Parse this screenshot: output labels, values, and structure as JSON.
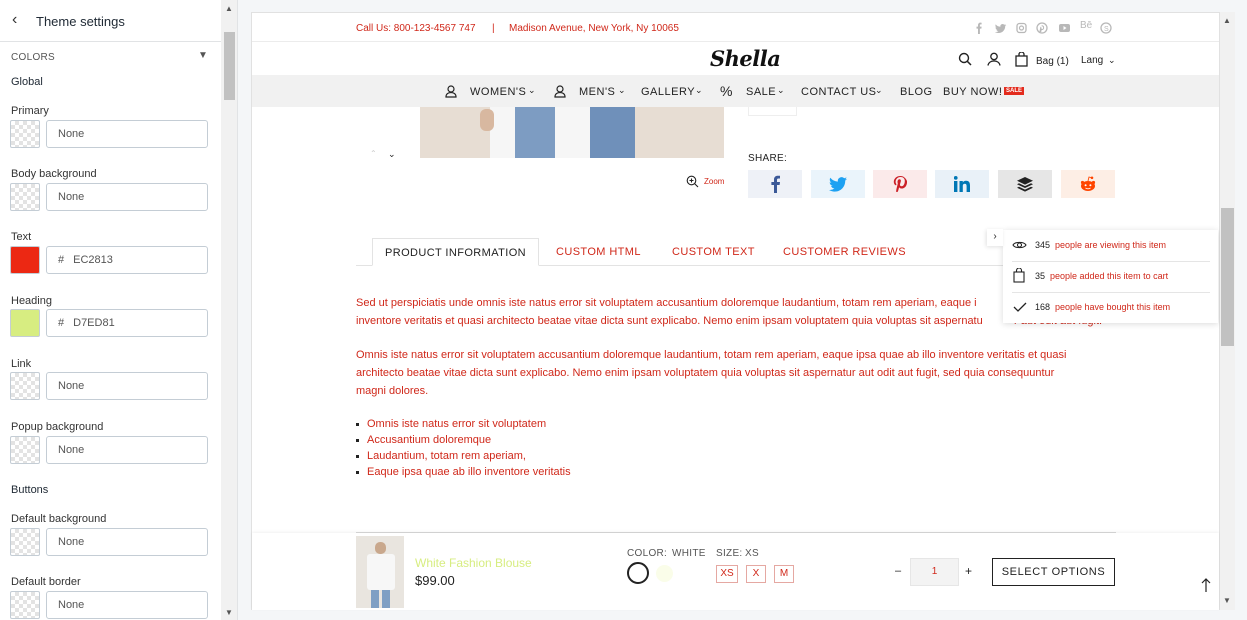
{
  "sidebar": {
    "title": "Theme settings",
    "section": "COLORS",
    "global_label": "Global",
    "fields": [
      {
        "label": "Primary",
        "value": "None",
        "swatch": "checker"
      },
      {
        "label": "Body background",
        "value": "None",
        "swatch": "checker"
      },
      {
        "label": "Text",
        "value": "EC2813",
        "swatch": "#ec2813",
        "hex": true
      },
      {
        "label": "Heading",
        "value": "D7ED81",
        "swatch": "#d7ed81",
        "hex": true
      },
      {
        "label": "Link",
        "value": "None",
        "swatch": "checker"
      },
      {
        "label": "Popup background",
        "value": "None",
        "swatch": "checker"
      }
    ],
    "buttons_label": "Buttons",
    "button_fields": [
      {
        "label": "Default background",
        "value": "None"
      },
      {
        "label": "Default border",
        "value": "None"
      }
    ],
    "hash": "#"
  },
  "topbar": {
    "phone": "Call Us: 800-123-4567 747",
    "separator": "|",
    "address": "Madison Avenue, New York, Ny 10065",
    "social_icons": [
      "facebook-icon",
      "twitter-icon",
      "instagram-icon",
      "pinterest-icon",
      "youtube-icon",
      "behance-icon",
      "skype-icon"
    ],
    "behance_text": "Bē"
  },
  "header": {
    "logo": "Shella",
    "bag": "Bag (1)",
    "lang": "Lang"
  },
  "nav": {
    "womens": "WOMEN'S",
    "mens": "MEN'S",
    "gallery": "GALLERY",
    "percent": "%",
    "sale": "SALE",
    "contact": "CONTACT US",
    "blog": "BLOG",
    "buynow": "BUY NOW!",
    "sale_badge": "SALE"
  },
  "product": {
    "zoom": "Zoom",
    "share_label": "SHARE:"
  },
  "tabs": [
    "PRODUCT INFORMATION",
    "CUSTOM HTML",
    "CUSTOM TEXT",
    "CUSTOMER REVIEWS"
  ],
  "description": {
    "p1_l1": "Sed ut perspiciatis unde omnis iste natus error sit voluptatem accusantium doloremque laudantium, totam rem aperiam, eaque i",
    "p1_l2": "inventore veritatis et quasi architecto beatae vitae dicta sunt explicabo. Nemo enim ipsam voluptatem quia voluptas sit aspernatu",
    "p1_l2_hidden": "r aut odit aut fugit.",
    "p2_l1": "Omnis iste natus error sit voluptatem accusantium doloremque laudantium, totam rem aperiam, eaque ipsa quae ab illo inventore veritatis et quasi",
    "p2_l2": "architecto beatae vitae dicta sunt explicabo. Nemo enim ipsam voluptatem quia voluptas sit aspernatur aut odit aut fugit, sed quia consequuntur",
    "p2_l3": "magni dolores.",
    "bullets": [
      "Omnis iste natus error sit voluptatem",
      "Accusantium doloremque",
      "Laudantium, totam rem aperiam,",
      "Eaque ipsa quae ab illo inventore veritatis"
    ]
  },
  "popup": {
    "rows": [
      {
        "count": "345",
        "text": "people are viewing this item",
        "icon": "eye-icon"
      },
      {
        "count": "35",
        "text": "people added this item to cart",
        "icon": "bag-icon"
      },
      {
        "count": "168",
        "text": "people have bought this item",
        "icon": "check-icon"
      }
    ]
  },
  "sticky": {
    "name": "White Fashion Blouse",
    "price": "$99.00",
    "color_label": "COLOR:",
    "color_value": "WHITE",
    "size_label": "SIZE:",
    "size_value": "XS",
    "sizes": [
      "XS",
      "X",
      "M"
    ],
    "qty": "1",
    "minus": "–",
    "plus": "+",
    "select": "SELECT OPTIONS"
  },
  "colors": {
    "text": "#ec2813",
    "heading": "#d7ed81",
    "sale": "#e32b1d"
  }
}
